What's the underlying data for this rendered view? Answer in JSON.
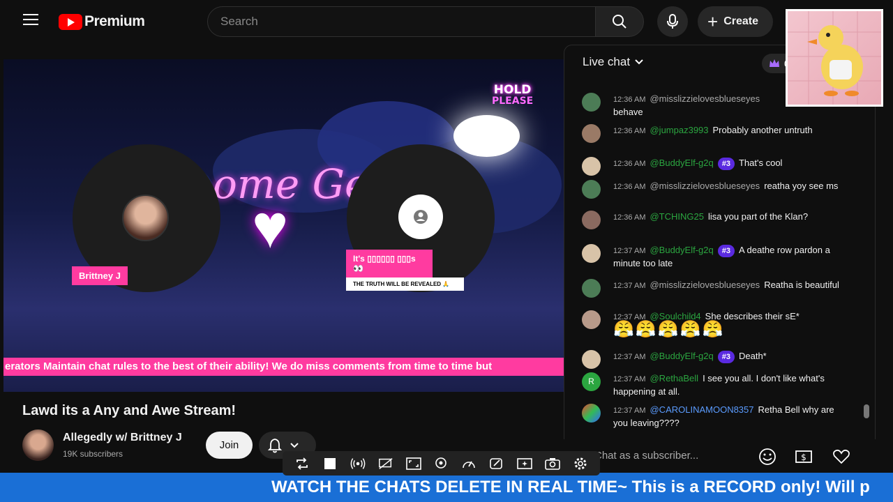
{
  "app": {
    "brand": "Premium"
  },
  "search": {
    "placeholder": "Search"
  },
  "header": {
    "create_label": "Create"
  },
  "video": {
    "hold_line1": "HOLD",
    "hold_line2": "PLEASE",
    "neon_text": "ome Get C",
    "host_name": "Brittney J",
    "guest_tag": "It's ▯▯▯▯▯▯ ▯▯▯s👀",
    "guest_sub": "THE TRUTH WILL BE REVEALED 🙏",
    "ticker": "erators Maintain chat rules to the best of their ability! We do miss comments from time to time but"
  },
  "meta": {
    "title": "Lawd its a Any and Awe Stream!",
    "channel": "Allegedly w/ Brittney J",
    "subscribers": "19K subscribers",
    "join_label": "Join"
  },
  "chat": {
    "header": "Live chat",
    "crown_count": "0",
    "input_placeholder": "Chat as a subscriber...",
    "messages": [
      {
        "time": "12:36 AM",
        "user": "@misslizzielovesblueseyes",
        "badge": "",
        "text": "behave"
      },
      {
        "time": "12:36 AM",
        "user": "@jumpaz3993",
        "badge": "",
        "text": "Probably another untruth"
      },
      {
        "time": "12:36 AM",
        "user": "@BuddyElf-g2q",
        "badge": "#3",
        "text": "That's cool"
      },
      {
        "time": "12:36 AM",
        "user": "@misslizzielovesblueseyes",
        "badge": "",
        "text": "reatha yoy see ms"
      },
      {
        "time": "12:36 AM",
        "user": "@TCHING25",
        "badge": "",
        "text": "lisa you part of the Klan?"
      },
      {
        "time": "12:37 AM",
        "user": "@BuddyElf-g2q",
        "badge": "#3",
        "text": "A deathe row pardon a minute too late"
      },
      {
        "time": "12:37 AM",
        "user": "@misslizzielovesblueseyes",
        "badge": "",
        "text": "Reatha is beautiful"
      },
      {
        "time": "12:37 AM",
        "user": "@Soulchild4",
        "badge": "",
        "text": "She describes their sE*"
      },
      {
        "time": "12:37 AM",
        "user": "@BuddyElf-g2q",
        "badge": "#3",
        "text": "Death*"
      },
      {
        "time": "12:37 AM",
        "user": "@RethaBell",
        "badge": "",
        "text": "I see you all. I don't like what's happening at all."
      },
      {
        "time": "12:37 AM",
        "user": "@CAROLINAMOON8357",
        "badge": "",
        "text": "Retha Bell why are you leaving????"
      }
    ],
    "emoji_row": "😤😤😤😤😤"
  },
  "bottom_ticker": "WATCH THE CHATS DELETE IN REAL TIME~ This is a RECORD only! Will p",
  "colors": {
    "accent_pink": "#ff3ba0",
    "ticker_blue": "#1a6fd6",
    "member_green": "#2ba640",
    "badge_purple": "#5a2ae0"
  }
}
